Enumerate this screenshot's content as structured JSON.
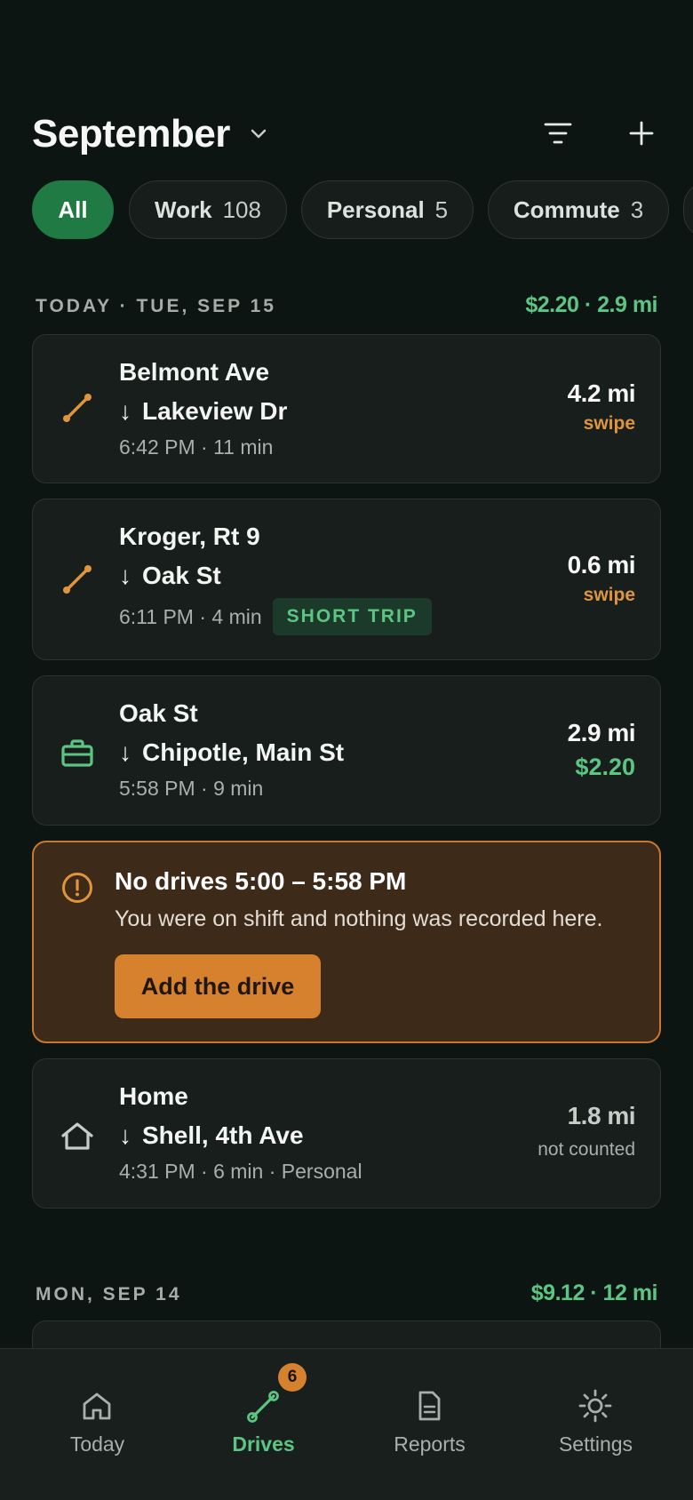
{
  "header": {
    "title": "September",
    "chevron_icon": "chevron-down-icon",
    "filter_icon": "filter-icon",
    "add_icon": "plus-icon"
  },
  "filters": [
    {
      "label": "All",
      "count": "",
      "active": true
    },
    {
      "label": "Work",
      "count": "108",
      "active": false
    },
    {
      "label": "Personal",
      "count": "5",
      "active": false
    },
    {
      "label": "Commute",
      "count": "3",
      "active": false
    }
  ],
  "sections": [
    {
      "label": "TODAY · TUE, SEP 15",
      "summary": "$2.20 · 2.9 mi",
      "drives": [
        {
          "from": "Belmont Ave",
          "to": "Lakeview Dr",
          "meta": "6:42 PM · 11 min",
          "distance": "4.2 mi",
          "sub": "swipe",
          "icon": "route-icon",
          "color": "#e0953d"
        },
        {
          "from": "Kroger, Rt 9",
          "to": "Oak St",
          "meta": "6:11 PM · 4 min",
          "badge": "SHORT TRIP",
          "distance": "0.6 mi",
          "sub": "swipe",
          "icon": "route-icon",
          "color": "#e0953d"
        },
        {
          "from": "Oak St",
          "to": "Chipotle, Main St",
          "meta": "5:58 PM · 9 min",
          "distance": "2.9 mi",
          "sub": "$2.20",
          "icon": "briefcase-icon",
          "color": "#5cc584"
        },
        {
          "from": "Home",
          "to": "Shell, 4th Ave",
          "meta": "4:31 PM · 6 min · Personal",
          "distance": "1.8 mi",
          "sub": "not counted",
          "icon": "home-icon",
          "color": "#c7ccc8"
        }
      ],
      "alert": {
        "title": "No drives 5:00 – 5:58 PM",
        "text": "You were on shift and nothing was recorded here.",
        "button": "Add the drive",
        "icon": "alert-circle-icon"
      }
    },
    {
      "label": "MON, SEP 14",
      "summary": "$9.12 · 12 mi"
    }
  ],
  "tabs": [
    {
      "label": "Today",
      "icon": "home-icon",
      "active": false
    },
    {
      "label": "Drives",
      "icon": "route-icon",
      "active": true,
      "badge": "6"
    },
    {
      "label": "Reports",
      "icon": "document-icon",
      "active": false
    },
    {
      "label": "Settings",
      "icon": "gear-icon",
      "active": false
    }
  ],
  "colors": {
    "accent": "#5cc584",
    "warning": "#d6812d",
    "background": "#0d1512"
  }
}
